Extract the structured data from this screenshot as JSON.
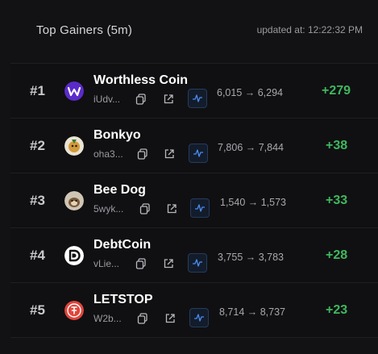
{
  "header": {
    "title": "Top Gainers (5m)",
    "updated": "updated at: 12:22:32 PM"
  },
  "colors": {
    "gain": "#3fb75e",
    "chart_accent": "#4a8df0"
  },
  "rows": [
    {
      "rank": "#1",
      "name": "Worthless Coin",
      "address": "iUdv...",
      "range": "6,015 → 6,294",
      "gain": "+279",
      "avatar": "worthless-coin-logo"
    },
    {
      "rank": "#2",
      "name": "Bonkyo",
      "address": "oha3...",
      "range": "7,806 → 7,844",
      "gain": "+38",
      "avatar": "bonkyo-logo"
    },
    {
      "rank": "#3",
      "name": "Bee Dog",
      "address": "5wyk...",
      "range": "1,540 → 1,573",
      "gain": "+33",
      "avatar": "bee-dog-logo"
    },
    {
      "rank": "#4",
      "name": "DebtCoin",
      "address": "vLie...",
      "range": "3,755 → 3,783",
      "gain": "+28",
      "avatar": "debtcoin-logo"
    },
    {
      "rank": "#5",
      "name": "LETSTOP",
      "address": "W2b...",
      "range": "8,714 → 8,737",
      "gain": "+23",
      "avatar": "letstop-logo"
    }
  ]
}
